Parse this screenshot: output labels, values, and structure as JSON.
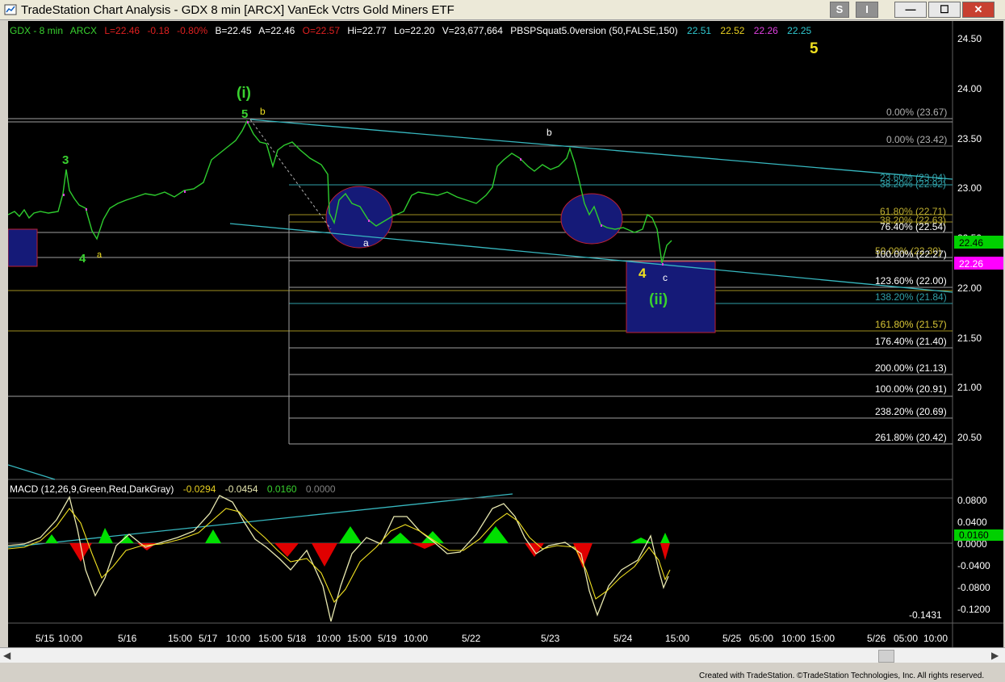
{
  "window": {
    "title": "TradeStation Chart Analysis - GDX 8 min [ARCX] VanEck Vctrs Gold Miners ETF",
    "buttons": {
      "s": "S",
      "i": "I",
      "minimize": "—",
      "maximize": "☐",
      "close": "✕"
    }
  },
  "header": {
    "symbol": "GDX - 8 min",
    "exchange": "ARCX",
    "last": "L=22.46",
    "change": "-0.18",
    "pct": "-0.80%",
    "bid": "B=22.45",
    "ask": "A=22.46",
    "open": "O=22.57",
    "high": "Hi=22.77",
    "low": "Lo=22.20",
    "volume": "V=23,677,664",
    "indicator": "PBSPSquat5.0version (50,FALSE,150)",
    "ind_values": [
      "22.51",
      "22.52",
      "22.26",
      "22.25"
    ]
  },
  "macd_header": {
    "label": "MACD (12,26,9,Green,Red,DarkGray)",
    "values": [
      "-0.0294",
      "-0.0454",
      "0.0160",
      "0.0000"
    ]
  },
  "price_axis": [
    "24.50",
    "24.00",
    "23.50",
    "23.00",
    "22.50",
    "22.00",
    "21.50",
    "21.00",
    "20.50"
  ],
  "macd_axis": [
    "0.0800",
    "0.0400",
    "0.0000",
    "-0.0400",
    "-0.0800",
    "-0.1200"
  ],
  "macd_flags": {
    "last": "0.0160",
    "min": "-0.1431"
  },
  "price_flags": {
    "last": "22.46",
    "level": "22.26",
    "hidden": "22.51"
  },
  "time_axis": [
    "5/15",
    "10:00",
    "5/16",
    "15:00",
    "5/17",
    "10:00",
    "15:00",
    "5/18",
    "10:00",
    "15:00",
    "5/19",
    "10:00",
    "5/22",
    "5/23",
    "5/24",
    "15:00",
    "5/25",
    "05:00",
    "10:00",
    "15:00",
    "5/26",
    "05:00",
    "10:00"
  ],
  "fib_labels": [
    "0.00% (23.67)",
    "0.00% (23.42)",
    "23.60% (23.04)",
    "38.20% (22.92)",
    "61.80% (22.71)",
    "38.20% (22.63)",
    "76.40% (22.54)",
    "50.00% (22.30)",
    "100.00% (22.27)",
    "123.60% (22.00)",
    "138.20% (21.84)",
    "161.80% (21.57)",
    "161.80% (21.57)",
    "176.40% (21.40)",
    "200.00% (21.13)",
    "100.00% (20.91)",
    "238.20% (20.69)",
    "261.80% (20.42)"
  ],
  "wave_labels": [
    "(i)",
    "5",
    "b",
    "3",
    "4",
    "a",
    "a",
    "b",
    "4",
    "c",
    "(ii)",
    "5"
  ],
  "colors": {
    "background": "#000000",
    "price_bars": "#2ecc2e",
    "trendline": "#37b8c0",
    "fib_line": "#a0a0a0",
    "box_fill": "#151a78",
    "box_border": "#c02030",
    "wave_green": "#39d12f",
    "wave_yellow": "#f0e020",
    "macd_up": "#00e000",
    "macd_down": "#e00000",
    "macd_line": "#e8e8b0"
  },
  "credit": "Created with TradeStation. ©TradeStation Technologies, Inc. All rights reserved."
}
